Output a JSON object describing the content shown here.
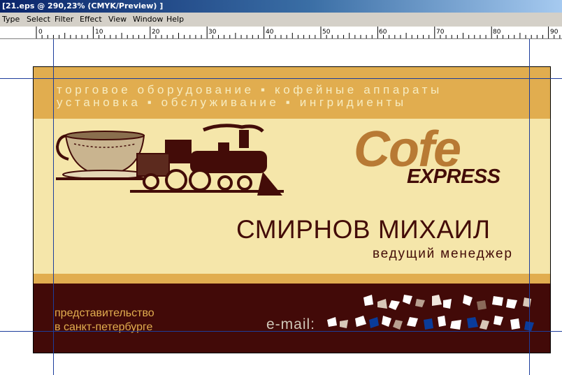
{
  "window": {
    "title": "[21.eps @ 290,23% (CMYK/Preview) ]"
  },
  "menu": {
    "items": [
      "Type",
      "Select",
      "Filter",
      "Effect",
      "View",
      "Window",
      "Help"
    ]
  },
  "ruler": {
    "labels": [
      "0",
      "10",
      "20",
      "30",
      "40",
      "50",
      "60",
      "70",
      "80",
      "90"
    ]
  },
  "card": {
    "tagline_line1": "торговое оборудование ▪ кофейные аппараты",
    "tagline_line2": "установка ▪ обслуживание ▪ ингридиенты",
    "brand_name": "Cofe",
    "brand_sub": "EXPRESS",
    "person_name": "СМИРНОВ МИХАИЛ",
    "person_title": "ведущий менеджер",
    "office_line1": "представительство",
    "office_line2": "в санкт-петербурге",
    "email_label": "e-mail:"
  },
  "colors": {
    "gold": "#e1ad4f",
    "cream": "#f5e6aa",
    "maroon": "#420a08",
    "brand_brown": "#b87a34",
    "guide_blue": "#1c3d9c"
  },
  "icons": {
    "illustration": "teacup-and-steam-locomotive",
    "redaction": "confetti-scrambled-email"
  }
}
